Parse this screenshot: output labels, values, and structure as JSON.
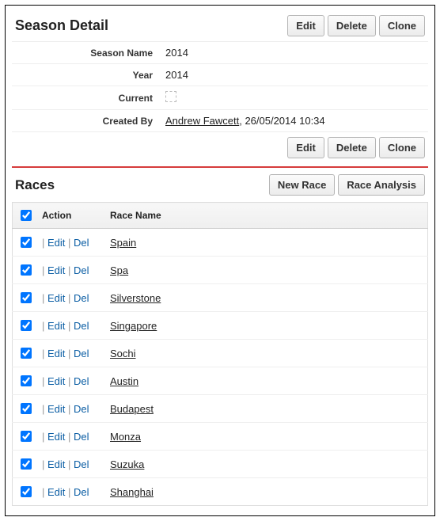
{
  "header": {
    "title": "Season Detail",
    "buttons": {
      "edit": "Edit",
      "delete": "Delete",
      "clone": "Clone"
    }
  },
  "detail": {
    "labels": {
      "season_name": "Season Name",
      "year": "Year",
      "current": "Current",
      "created_by": "Created By"
    },
    "season_name": "2014",
    "year": "2014",
    "current": false,
    "created_by_user": "Andrew Fawcett",
    "created_by_datetime": "26/05/2014 10:34"
  },
  "footer_buttons": {
    "edit": "Edit",
    "delete": "Delete",
    "clone": "Clone"
  },
  "related": {
    "title": "Races",
    "buttons": {
      "new_race": "New Race",
      "race_analysis": "Race Analysis"
    },
    "columns": {
      "action": "Action",
      "race_name": "Race Name"
    },
    "action_labels": {
      "edit": "Edit",
      "del": "Del"
    },
    "rows": [
      {
        "name": "Spain"
      },
      {
        "name": "Spa"
      },
      {
        "name": "Silverstone"
      },
      {
        "name": "Singapore"
      },
      {
        "name": "Sochi"
      },
      {
        "name": "Austin"
      },
      {
        "name": "Budapest"
      },
      {
        "name": "Monza"
      },
      {
        "name": "Suzuka"
      },
      {
        "name": "Shanghai"
      }
    ]
  }
}
